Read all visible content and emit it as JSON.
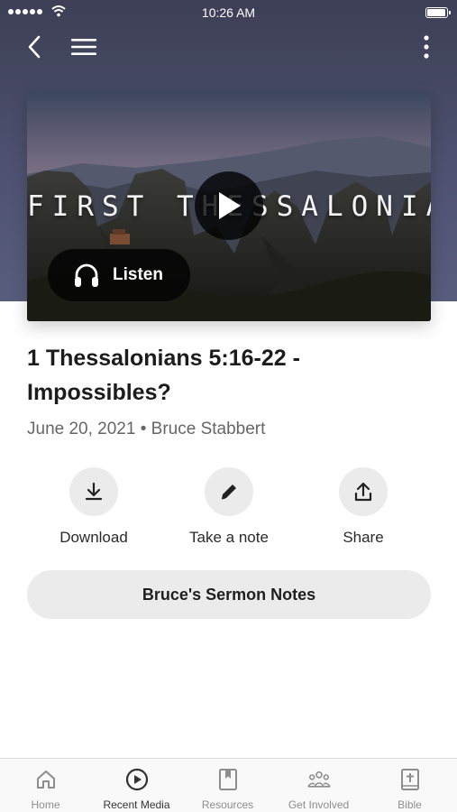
{
  "status_bar": {
    "time": "10:26 AM"
  },
  "artwork": {
    "title": "FIRST THESSALONIANS",
    "listen_label": "Listen"
  },
  "sermon": {
    "title": "1 Thessalonians 5:16-22 - Impossibles?",
    "date": "June 20, 2021",
    "separator": "•",
    "speaker": "Bruce Stabbert"
  },
  "actions": [
    {
      "label": "Download",
      "icon": "download-icon"
    },
    {
      "label": "Take a note",
      "icon": "pencil-icon"
    },
    {
      "label": "Share",
      "icon": "share-icon"
    }
  ],
  "notes_button": {
    "label": "Bruce's Sermon Notes"
  },
  "tab_bar": {
    "active": "Recent Media",
    "tabs": [
      {
        "label": "Home",
        "icon": "home-icon"
      },
      {
        "label": "Recent Media",
        "icon": "play-circle-icon"
      },
      {
        "label": "Resources",
        "icon": "bookmark-icon"
      },
      {
        "label": "Get Involved",
        "icon": "people-icon"
      },
      {
        "label": "Bible",
        "icon": "bible-icon"
      }
    ]
  },
  "colors": {
    "header_bg": "#4e5170",
    "button_bg": "#ebebeb",
    "tab_active": "#333333",
    "tab_inactive": "#8d8d8d"
  }
}
